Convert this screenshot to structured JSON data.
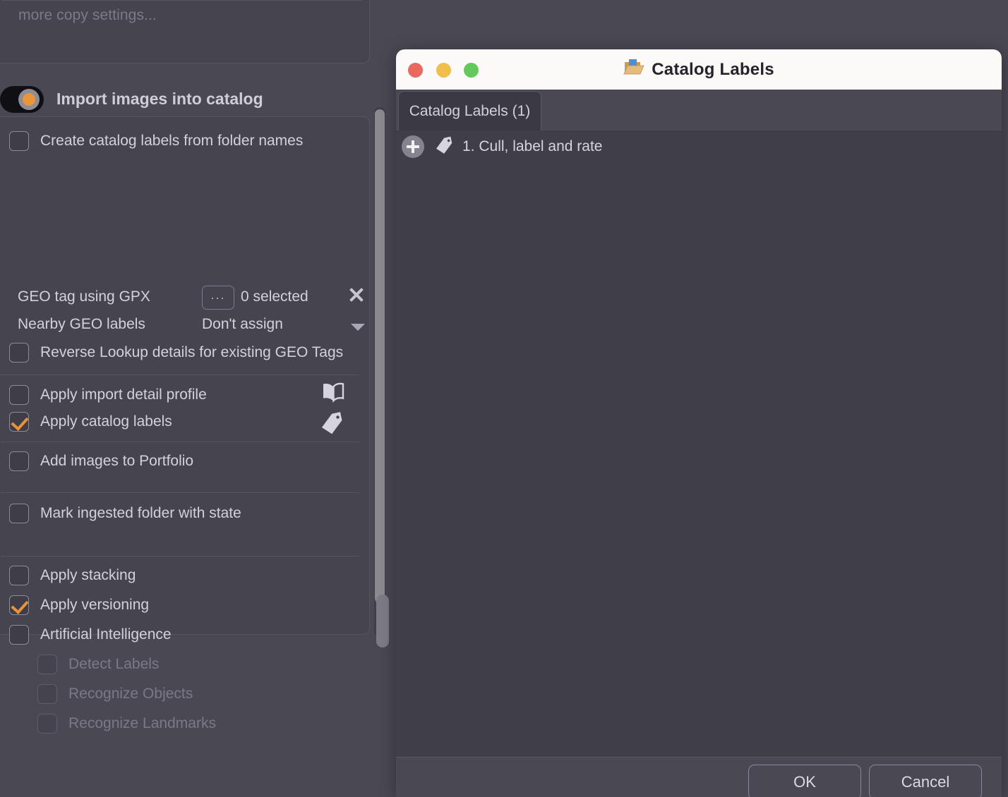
{
  "left_panel": {
    "copy_group": {
      "more_settings_label": "more copy settings..."
    },
    "import_toggle": {
      "label": "Import images into catalog",
      "state": "on",
      "accent": "#e8953c"
    },
    "options": [
      {
        "label": "Create catalog labels from folder names",
        "checked": false,
        "enabled": true
      },
      {
        "label": "Reverse Lookup details for existing GEO Tags",
        "checked": false,
        "enabled": true
      },
      {
        "label": "Apply import detail profile",
        "checked": false,
        "enabled": true,
        "icon": "open-book-icon"
      },
      {
        "label": "Apply catalog labels",
        "checked": true,
        "enabled": true,
        "icon": "tag-icon"
      },
      {
        "label": "Add images to Portfolio",
        "checked": false,
        "enabled": true
      },
      {
        "label": "Mark ingested folder with state",
        "checked": false,
        "enabled": true
      },
      {
        "label": "Apply stacking",
        "checked": false,
        "enabled": true
      },
      {
        "label": "Apply versioning",
        "checked": true,
        "enabled": true
      },
      {
        "label": "Artificial Intelligence",
        "checked": false,
        "enabled": true
      },
      {
        "label": "Detect Labels",
        "checked": false,
        "enabled": false
      },
      {
        "label": "Recognize Objects",
        "checked": false,
        "enabled": false
      },
      {
        "label": "Recognize Landmarks",
        "checked": false,
        "enabled": false
      }
    ],
    "geo": {
      "gpx_label": "GEO tag using GPX",
      "browse_button": "...",
      "selected_text": "0 selected",
      "clear_icon": "close-x-icon",
      "nearby_label": "Nearby GEO labels",
      "nearby_value": "Don't assign"
    }
  },
  "dialog": {
    "title": "Catalog Labels",
    "title_icon": "open-folder-icon",
    "window_controls": {
      "close": "close-button",
      "minimize": "minimize-button",
      "maximize": "maximize-button",
      "close_color": "#e8695f",
      "minimize_color": "#f1bf4d",
      "maximize_color": "#63c95a"
    },
    "tabs": [
      {
        "label": "Catalog Labels (1)",
        "active": true
      }
    ],
    "list": {
      "add_icon": "plus-circle-icon",
      "items": [
        {
          "icon": "tag-icon",
          "label": "1. Cull, label and rate"
        }
      ]
    },
    "footer": {
      "ok_label": "OK",
      "cancel_label": "Cancel"
    }
  }
}
